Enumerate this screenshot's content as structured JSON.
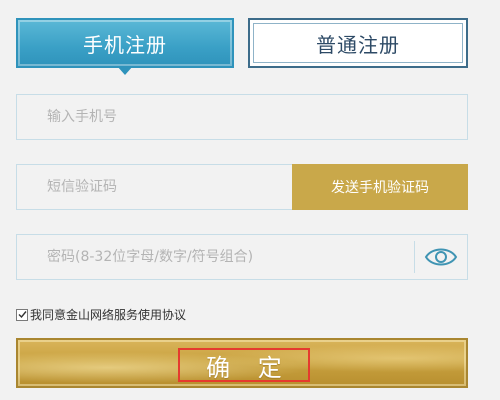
{
  "tabs": {
    "phone_register": "手机注册",
    "normal_register": "普通注册"
  },
  "form": {
    "phone_placeholder": "输入手机号",
    "sms_placeholder": "短信验证码",
    "send_sms_button": "发送手机验证码",
    "password_placeholder": "密码(8-32位字母/数字/符号组合)",
    "agreement_label": "我同意金山网络服务使用协议",
    "agreement_checked": true,
    "confirm_button": "确 定"
  },
  "icons": {
    "password_toggle": "eye-icon",
    "agreement_check": "checkmark-icon"
  },
  "colors": {
    "active_tab": "#3aa0c6",
    "inactive_tab_border": "#3d6c8a",
    "send_button": "#c9a84a",
    "confirm_button": "#c9a240",
    "highlight_box": "#e53a2f",
    "field_border": "#c7dde7",
    "page_background": "#f2f2f2"
  }
}
